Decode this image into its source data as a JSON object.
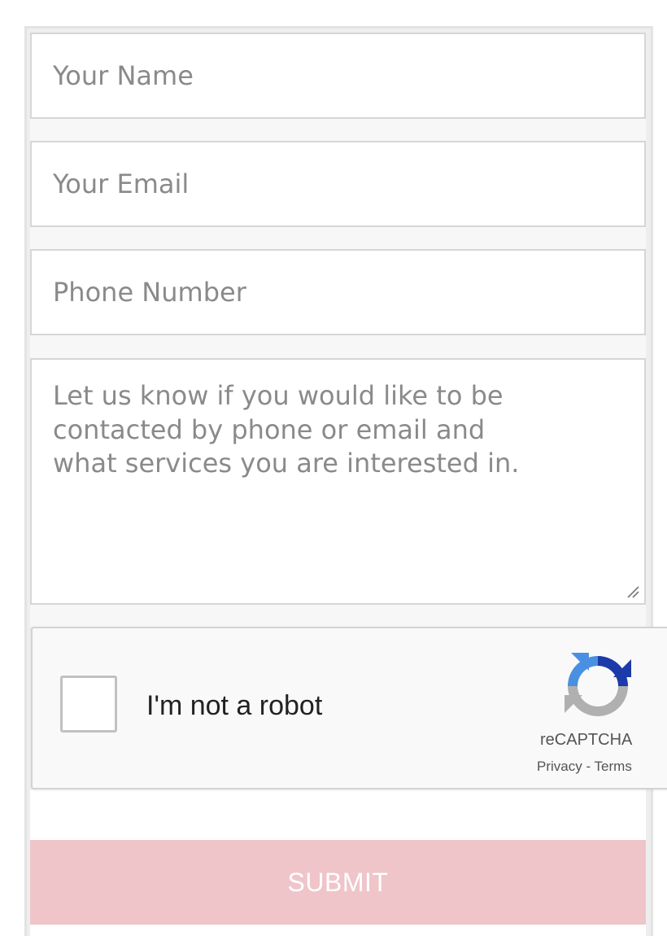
{
  "form": {
    "name_placeholder": "Your Name",
    "email_placeholder": "Your Email",
    "phone_placeholder": "Phone Number",
    "message_placeholder": "Let us know if you would like to be\ncontacted by phone or email and\nwhat services you are interested in.",
    "submit_label": "SUBMIT"
  },
  "recaptcha": {
    "label": "I'm not a robot",
    "brand": "reCAPTCHA",
    "privacy_link": "Privacy",
    "separator": " - ",
    "terms_link": "Terms",
    "checked": false,
    "logo_icon": "recaptcha-logo-icon"
  },
  "colors": {
    "submit_bg": "#efc5ca",
    "placeholder": "#8a8a8a",
    "field_border": "#d6d6d6",
    "recaptcha_bg": "#f9f9f9",
    "recaptcha_blue": "#1c3aa9",
    "recaptcha_lightblue": "#4a90e2",
    "recaptcha_gray": "#b0b0b0"
  }
}
